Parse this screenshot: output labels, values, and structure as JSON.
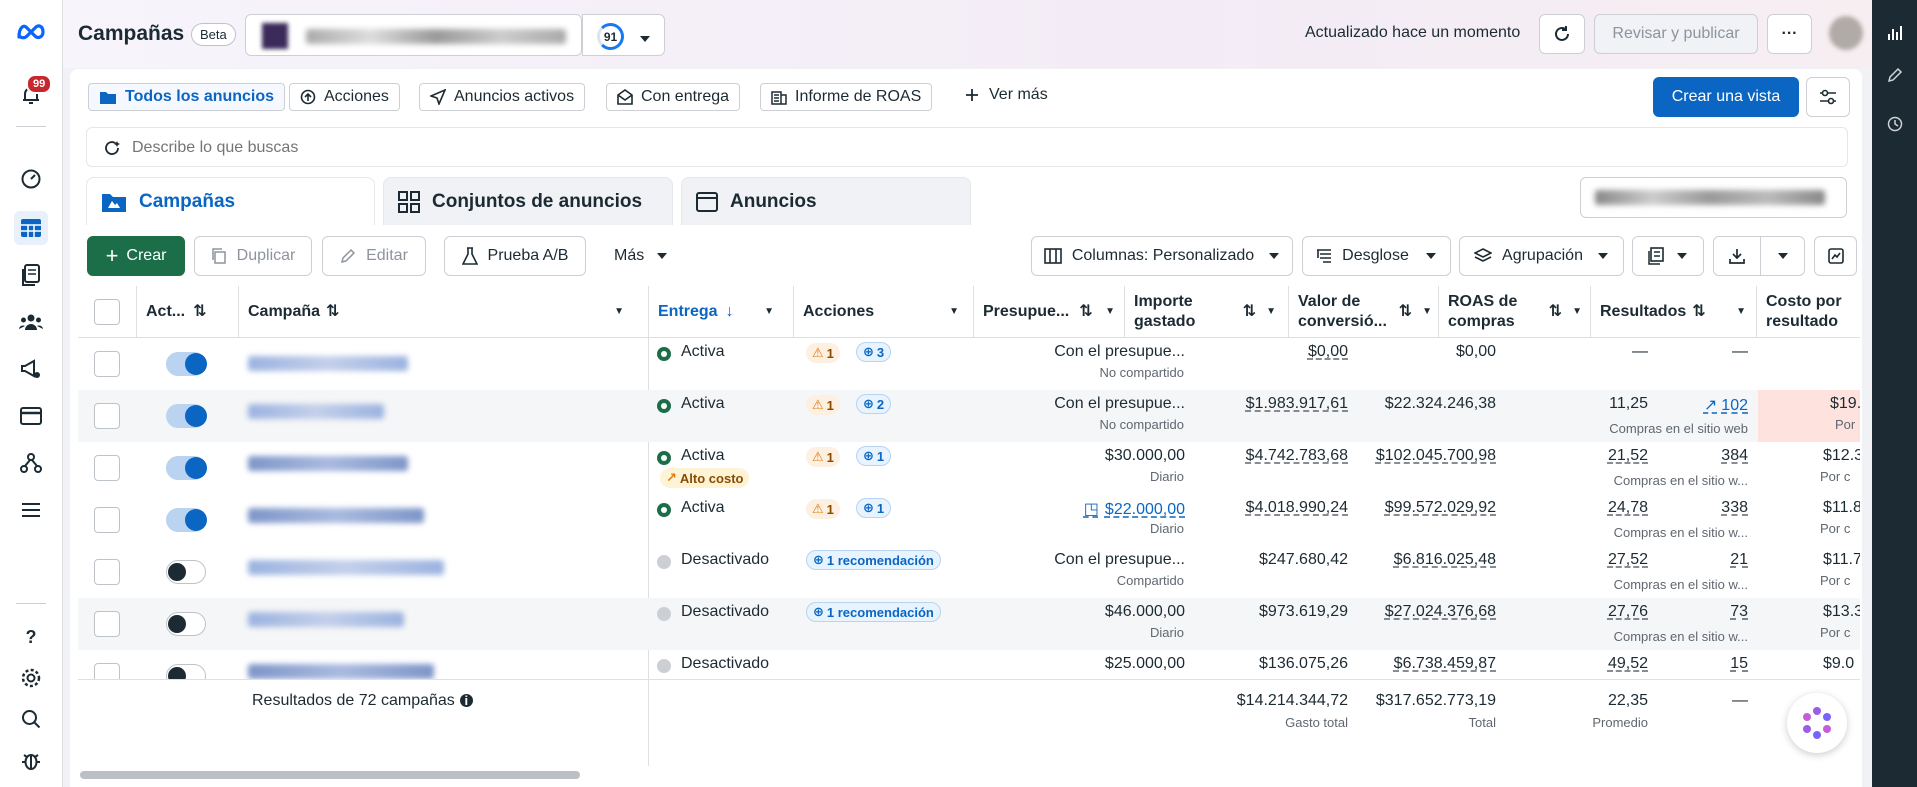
{
  "header": {
    "title": "Campañas",
    "beta": "Beta",
    "score": "91",
    "updated": "Actualizado hace un momento",
    "review": "Revisar y publicar",
    "more": "···"
  },
  "notifications": {
    "count": "99"
  },
  "views": {
    "items": [
      "Todos los anuncios",
      "Acciones",
      "Anuncios activos",
      "Con entrega",
      "Informe de ROAS"
    ],
    "see_more": "Ver más",
    "create_view": "Crear una vista"
  },
  "search": {
    "placeholder": "Describe lo que buscas"
  },
  "tabs": {
    "campaigns": "Campañas",
    "adsets": "Conjuntos de anuncios",
    "ads": "Anuncios"
  },
  "toolbar": {
    "create": "Crear",
    "duplicate": "Duplicar",
    "edit": "Editar",
    "ab": "Prueba A/B",
    "more": "Más",
    "columns": "Columnas: Personalizado",
    "breakdown": "Desglose",
    "grouping": "Agrupación"
  },
  "columns": {
    "act": "Act...",
    "campaign": "Campaña",
    "delivery": "Entrega",
    "actions": "Acciones",
    "budget": "Presupue...",
    "spent": "Importe gastado",
    "conv": "Valor de conversió...",
    "roas": "ROAS de compras",
    "results": "Resultados",
    "cpr": "Costo por resultado"
  },
  "rows": [
    {
      "status": "Activa",
      "warn": "1",
      "rec": "3",
      "budget": "Con el presupue...",
      "budget_sub": "No compartido",
      "spent": "$0,00",
      "conv": "$0,00",
      "roas": "—",
      "results": "—",
      "results_sub": "",
      "cpr": "",
      "cpr_sub": ""
    },
    {
      "status": "Activa",
      "warn": "1",
      "rec": "2",
      "budget": "Con el presupue...",
      "budget_sub": "No compartido",
      "spent": "$1.983.917,61",
      "conv": "$22.324.246,38",
      "roas": "11,25",
      "results": "102",
      "results_sub": "Compras en el sitio web",
      "cpr": "$19.",
      "cpr_sub": "Por"
    },
    {
      "status": "Activa",
      "cost_badge": "Alto costo",
      "warn": "1",
      "rec": "1",
      "budget": "$30.000,00",
      "budget_sub": "Diario",
      "spent": "$4.742.783,68",
      "conv": "$102.045.700,98",
      "roas": "21,52",
      "results": "384",
      "results_sub": "Compras en el sitio w...",
      "cpr": "$12.3",
      "cpr_sub": "Por c"
    },
    {
      "status": "Activa",
      "warn": "1",
      "rec": "1",
      "budget": "$22.000,00",
      "budget_sub": "Diario",
      "spent": "$4.018.990,24",
      "conv": "$99.572.029,92",
      "roas": "24,78",
      "results": "338",
      "results_sub": "Compras en el sitio w...",
      "cpr": "$11.8",
      "cpr_sub": "Por c"
    },
    {
      "status": "Desactivado",
      "rec_text": "1 recomendación",
      "budget": "Con el presupue...",
      "budget_sub": "Compartido",
      "spent": "$247.680,42",
      "conv": "$6.816.025,48",
      "roas": "27,52",
      "results": "21",
      "results_sub": "Compras en el sitio w...",
      "cpr": "$11.7",
      "cpr_sub": "Por c"
    },
    {
      "status": "Desactivado",
      "rec_text": "1 recomendación",
      "budget": "$46.000,00",
      "budget_sub": "Diario",
      "spent": "$973.619,29",
      "conv": "$27.024.376,68",
      "roas": "27,76",
      "results": "73",
      "results_sub": "Compras en el sitio w...",
      "cpr": "$13.3",
      "cpr_sub": "Por c"
    },
    {
      "status": "Desactivado",
      "budget": "$25.000,00",
      "budget_sub": "",
      "spent": "$136.075,26",
      "conv": "$6.738.459,87",
      "roas": "49,52",
      "results": "15",
      "results_sub": "",
      "cpr": "$9.0",
      "cpr_sub": ""
    }
  ],
  "footer": {
    "label": "Resultados de 72 campañas",
    "spent": "$14.214.344,72",
    "spent_sub": "Gasto total",
    "conv": "$317.652.773,19",
    "conv_sub": "Total",
    "roas": "22,35",
    "roas_sub": "Promedio",
    "results": "—"
  },
  "colors": {
    "accent": "#0a66c2",
    "green": "#1b6e48",
    "warn": "#e07a10"
  }
}
